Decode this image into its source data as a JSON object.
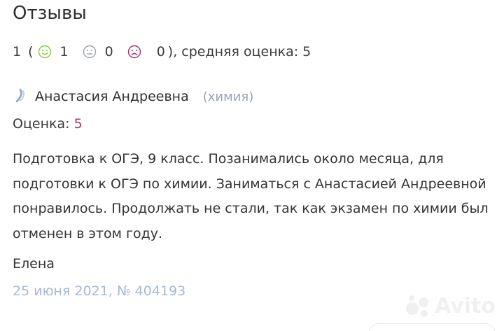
{
  "section": {
    "title": "Отзывы"
  },
  "summary": {
    "total": "1",
    "open_paren": "(",
    "positive_count": "1",
    "neutral_count": "0",
    "negative_count": "0",
    "close_text": "), средняя оценка: 5"
  },
  "icons": {
    "positive": "smile-face-icon",
    "neutral": "neutral-face-icon",
    "negative": "sad-face-icon",
    "quote": "quote-mark-icon"
  },
  "review": {
    "teacher_name": "Анастасия Андреевна",
    "subject": "(химия)",
    "rating_label": "Оценка: ",
    "rating_value": "5",
    "text": "Подготовка к ОГЭ, 9 класс. Позанимались около месяца, для подготовки к ОГЭ по химии. Заниматься с Анастасией Андреевной понравилось. Продолжать не стали, так как экзамен по химии был отменен в этом году.",
    "author": "Елена",
    "meta": "25 июня 2021, № 404193"
  },
  "watermark": {
    "text": "Avito"
  },
  "colors": {
    "positive": "#8cc63f",
    "neutral": "#9aa3b5",
    "negative": "#a3336e",
    "rating_value": "#a3336e",
    "meta": "#a7b8d6"
  }
}
